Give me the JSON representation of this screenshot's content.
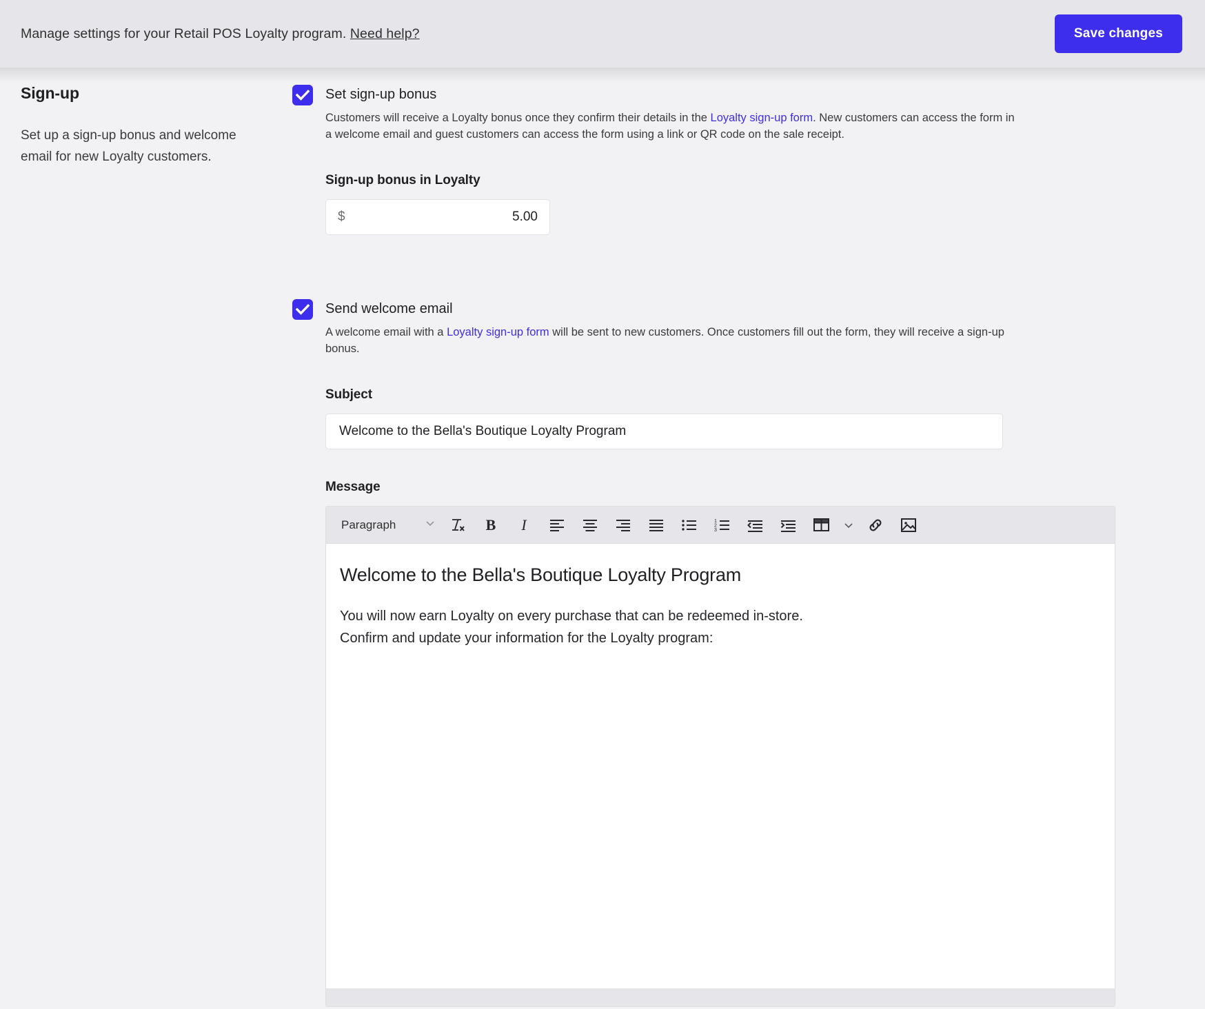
{
  "topbar": {
    "message": "Manage settings for your Retail POS Loyalty program.",
    "help_label": "Need help?",
    "save_label": "Save changes",
    "accent_color": "#3d2eee",
    "background_color": "#e6e5e9"
  },
  "section": {
    "title": "Sign-up",
    "description": "Set up a sign-up bonus and welcome email for new Loyalty customers."
  },
  "signup_bonus": {
    "checkbox_label": "Set sign-up bonus",
    "checked": true,
    "description_part1": "Customers will receive a Loyalty bonus once they confirm their details in the ",
    "description_link": "Loyalty sign-up form",
    "description_part2": ". New customers can access the form in a welcome email and guest customers can access the form using a link or QR code on the sale receipt.",
    "field_label": "Sign-up bonus in Loyalty",
    "currency_symbol": "$",
    "amount_value": "5.00"
  },
  "welcome_email": {
    "checkbox_label": "Send welcome email",
    "checked": true,
    "description_part1": "A welcome email with a ",
    "description_link": "Loyalty sign-up form",
    "description_part2": " will be sent to new customers. Once customers fill out the form, they will receive a sign-up bonus.",
    "subject_label": "Subject",
    "subject_value": "Welcome to the Bella's Boutique Loyalty Program",
    "message_label": "Message"
  },
  "editor": {
    "toolbar": {
      "block_format": "Paragraph",
      "items": [
        "chevron-down-icon",
        "clear-formatting-icon",
        "bold-icon",
        "italic-icon",
        "align-left-icon",
        "align-center-icon",
        "align-right-icon",
        "align-justify-icon",
        "bullet-list-icon",
        "numbered-list-icon",
        "outdent-icon",
        "indent-icon",
        "table-icon",
        "table-chevron-down-icon",
        "link-icon",
        "image-icon"
      ],
      "bold_label": "B",
      "italic_label": "I"
    },
    "content": {
      "heading": "Welcome to the Bella's Boutique Loyalty Program",
      "paragraph1": "You will now earn Loyalty on every purchase that can be redeemed in-store.",
      "paragraph2": "Confirm and update your information for the Loyalty program:"
    }
  }
}
